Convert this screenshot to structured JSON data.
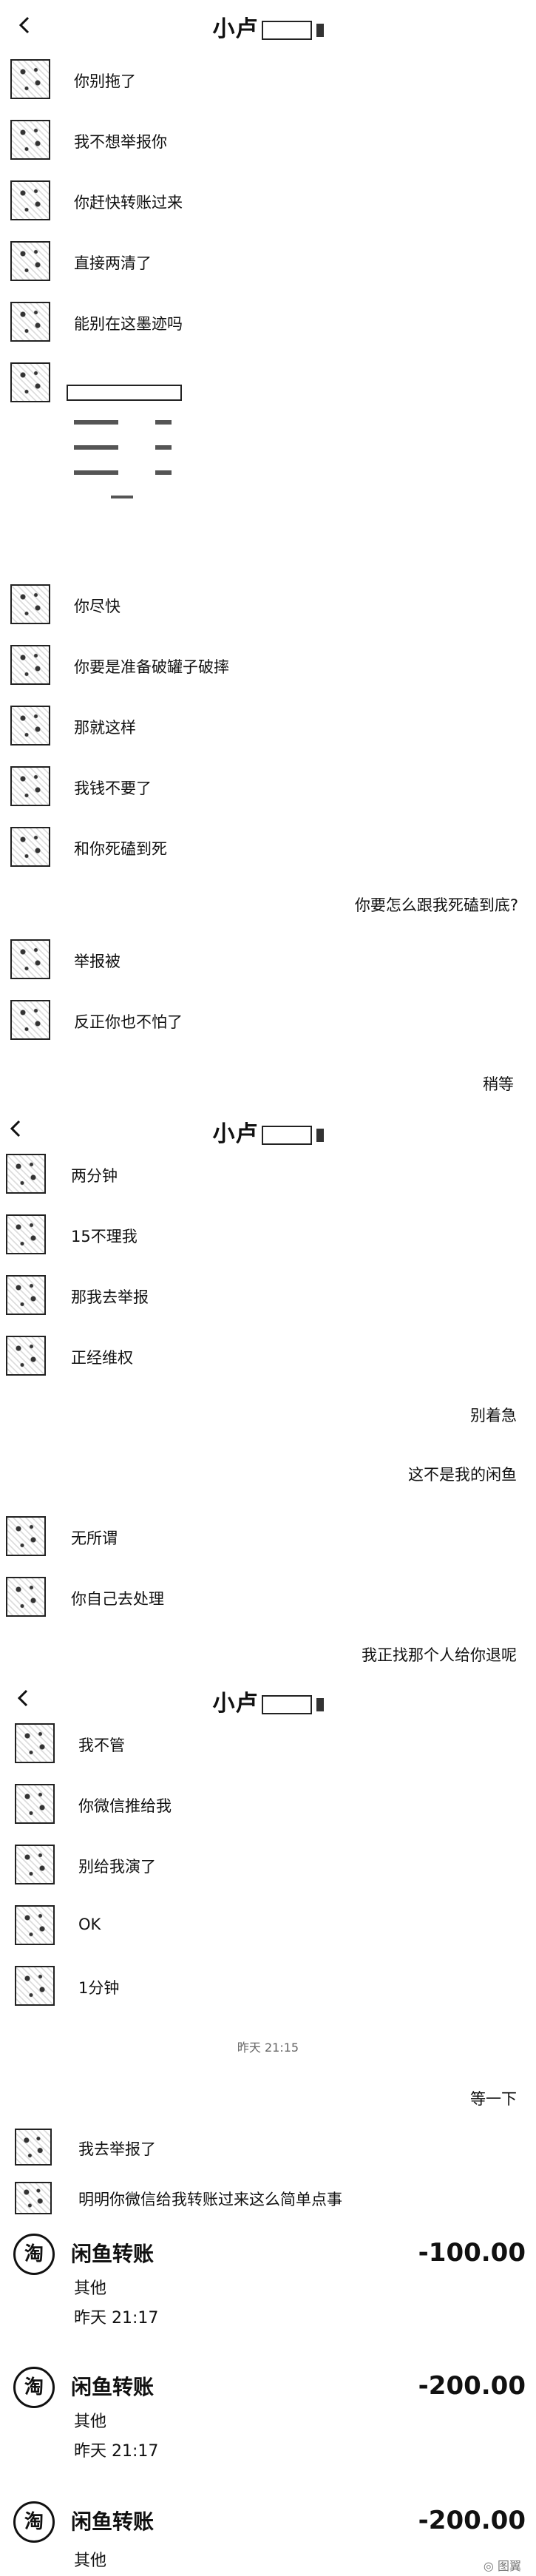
{
  "header1": {
    "title": "小卢"
  },
  "header2": {
    "title": "小卢"
  },
  "header3": {
    "title": "小卢"
  },
  "section1": {
    "messages_left_a": [
      "你别拖了",
      "我不想举报你",
      "你赶快转账过来",
      "直接两清了",
      "能别在这墨迹吗"
    ],
    "messages_left_b": [
      "你尽快",
      "你要是准备破罐子破摔",
      "那就这样",
      "我钱不要了",
      "和你死磕到死"
    ],
    "right_1": "你要怎么跟我死磕到底?",
    "messages_left_c": [
      "举报被",
      "反正你也不怕了"
    ],
    "right_2": "稍等"
  },
  "section2": {
    "messages_left_a": [
      "两分钟",
      "15不理我",
      "那我去举报",
      "正经维权"
    ],
    "right_1": "别着急",
    "right_2": "这不是我的闲鱼",
    "messages_left_b": [
      "无所谓",
      "你自己去处理"
    ],
    "right_3": "我正找那个人给你退呢"
  },
  "section3": {
    "messages_left_a": [
      "我不管",
      "你微信推给我",
      "别给我演了",
      "OK",
      "1分钟"
    ],
    "timestamp": "昨天 21:15",
    "right_1": "等一下",
    "messages_left_b": [
      "我去举报了",
      "明明你微信给我转账过来这么简单点事"
    ]
  },
  "transfers": [
    {
      "icon": "淘",
      "title": "闲鱼转账",
      "amount": "-100.00",
      "category": "其他",
      "time": "昨天 21:17"
    },
    {
      "icon": "淘",
      "title": "闲鱼转账",
      "amount": "-200.00",
      "category": "其他",
      "time": "昨天 21:17"
    },
    {
      "icon": "淘",
      "title": "闲鱼转账",
      "amount": "-200.00",
      "category": "其他",
      "time": ""
    }
  ],
  "watermark": "图翼"
}
